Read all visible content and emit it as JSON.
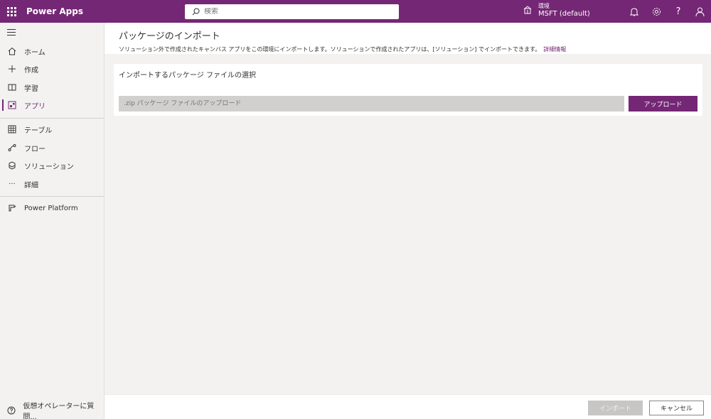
{
  "topbar": {
    "app_name": "Power Apps",
    "search_placeholder": "検索",
    "environment_label": "環境",
    "environment_name": "MSFT (default)",
    "icons": [
      "waffle-icon",
      "search-icon",
      "environment-icon",
      "bell-icon",
      "gear-icon",
      "help-icon",
      "person-icon"
    ],
    "help_glyph": "?"
  },
  "sidebar": {
    "items": [
      {
        "label": "ホーム",
        "icon": "home-icon"
      },
      {
        "label": "作成",
        "icon": "plus-icon"
      },
      {
        "label": "学習",
        "icon": "book-icon"
      },
      {
        "label": "アプリ",
        "icon": "apps-icon",
        "active": true
      },
      {
        "label": "テーブル",
        "icon": "table-icon"
      },
      {
        "label": "フロー",
        "icon": "flow-icon"
      },
      {
        "label": "ソリューション",
        "icon": "solution-icon"
      },
      {
        "label": "詳細",
        "icon": "more-icon"
      },
      {
        "label": "Power Platform",
        "icon": "power-platform-icon"
      }
    ],
    "more_glyph": "···",
    "bottom_label": "仮想オペレーターに質問..."
  },
  "main": {
    "title": "パッケージのインポート",
    "description": "ソリューション外で作成されたキャンバス アプリをこの環境にインポートします。ソリューションで作成されたアプリは、[ソリューション] でインポートできます。",
    "details_link": "詳細情報",
    "card": {
      "title": "インポートするパッケージ ファイルの選択",
      "file_placeholder": ".zip パッケージ ファイルのアップロード",
      "upload_label": "アップロード"
    }
  },
  "footer": {
    "import_label": "インポート",
    "cancel_label": "キャンセル"
  },
  "colors": {
    "brand": "#742774",
    "disabled": "#c8c6c4"
  }
}
